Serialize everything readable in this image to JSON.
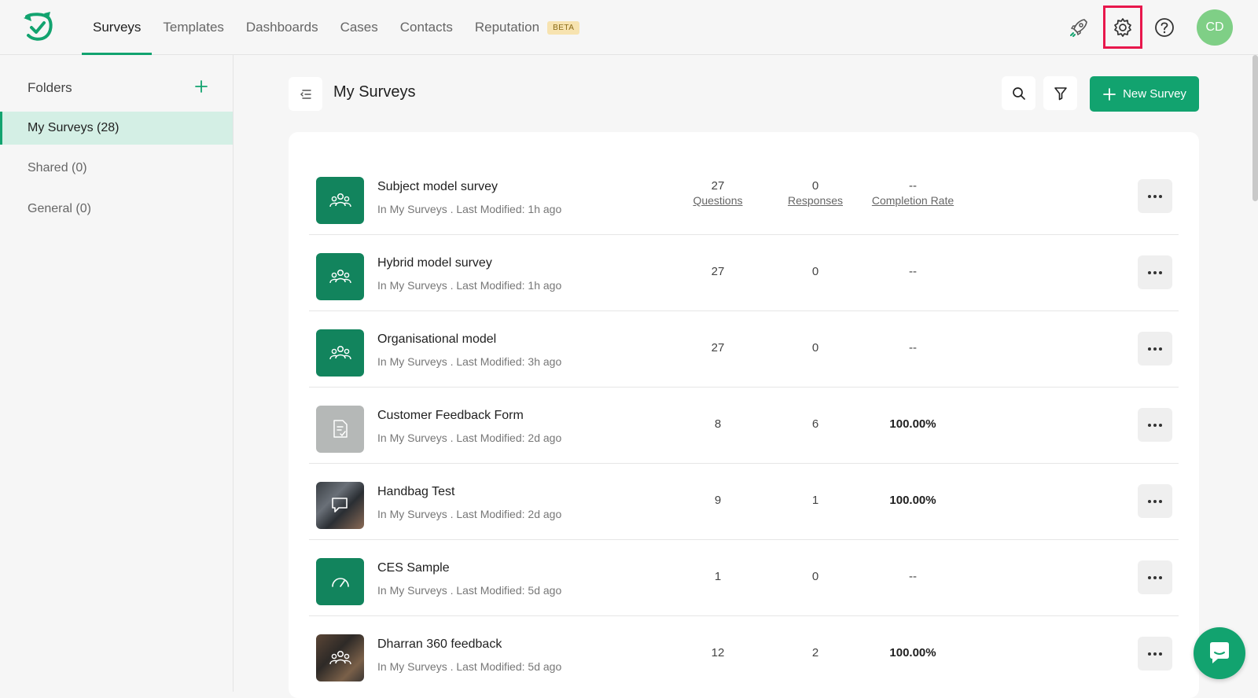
{
  "nav": {
    "items": [
      {
        "label": "Surveys",
        "active": true
      },
      {
        "label": "Templates",
        "active": false
      },
      {
        "label": "Dashboards",
        "active": false
      },
      {
        "label": "Cases",
        "active": false
      },
      {
        "label": "Contacts",
        "active": false
      },
      {
        "label": "Reputation",
        "active": false
      }
    ],
    "beta_badge": "BETA",
    "avatar_initials": "CD"
  },
  "sidebar": {
    "heading": "Folders",
    "items": [
      {
        "label": "My Surveys (28)",
        "active": true
      },
      {
        "label": "Shared (0)",
        "active": false
      },
      {
        "label": "General (0)",
        "active": false
      }
    ]
  },
  "main": {
    "title": "My Surveys",
    "new_survey_label": "New Survey",
    "column_labels": {
      "questions": "Questions",
      "responses": "Responses",
      "completion": "Completion Rate"
    },
    "surveys": [
      {
        "name": "Subject model survey",
        "meta": "In My Surveys . Last Modified: 1h ago",
        "questions": "27",
        "responses": "0",
        "completion": "--",
        "icon": "people-icon"
      },
      {
        "name": "Hybrid model survey",
        "meta": "In My Surveys . Last Modified: 1h ago",
        "questions": "27",
        "responses": "0",
        "completion": "--",
        "icon": "people-icon"
      },
      {
        "name": "Organisational model",
        "meta": "In My Surveys . Last Modified: 3h ago",
        "questions": "27",
        "responses": "0",
        "completion": "--",
        "icon": "people-icon"
      },
      {
        "name": "Customer Feedback Form",
        "meta": "In My Surveys . Last Modified: 2d ago",
        "questions": "8",
        "responses": "6",
        "completion": "100.00%",
        "icon": "form-icon"
      },
      {
        "name": "Handbag Test",
        "meta": "In My Surveys . Last Modified: 2d ago",
        "questions": "9",
        "responses": "1",
        "completion": "100.00%",
        "icon": "chat-photo-icon"
      },
      {
        "name": "CES Sample",
        "meta": "In My Surveys . Last Modified: 5d ago",
        "questions": "1",
        "responses": "0",
        "completion": "--",
        "icon": "gauge-icon"
      },
      {
        "name": "Dharran 360 feedback",
        "meta": "In My Surveys . Last Modified: 5d ago",
        "questions": "12",
        "responses": "2",
        "completion": "100.00%",
        "icon": "people-photo-icon"
      }
    ]
  },
  "colors": {
    "accent": "#12a36f",
    "highlight": "#e8174c",
    "avatar": "#7fcf86"
  }
}
